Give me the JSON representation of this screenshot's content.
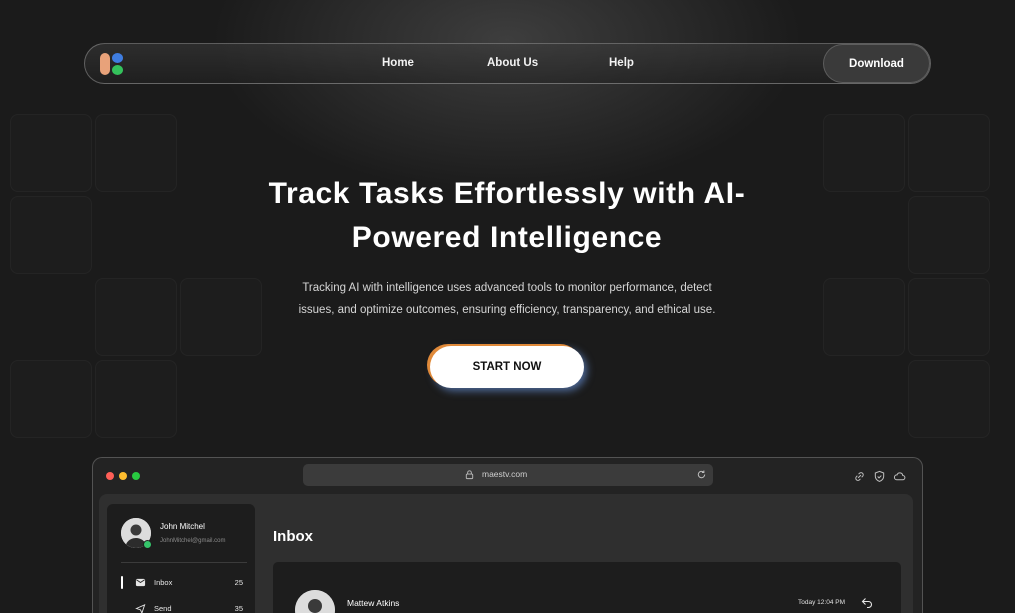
{
  "nav": {
    "links": [
      "Home",
      "About Us",
      "Help"
    ],
    "download_label": "Download"
  },
  "hero": {
    "title_line1": "Track Tasks Effortlessly with AI-",
    "title_line2": "Powered Intelligence",
    "subtitle_line1": "Tracking AI with intelligence uses advanced tools to monitor performance, detect",
    "subtitle_line2": "issues, and optimize outcomes, ensuring efficiency, transparency, and ethical use.",
    "cta_label": "START NOW"
  },
  "browser": {
    "url": "maestv.com",
    "traffic_lights": [
      "#ff5f57",
      "#febc2e",
      "#28c840"
    ],
    "toolbar_icons": [
      "link-icon",
      "shield-check-icon",
      "cloud-icon"
    ]
  },
  "app": {
    "user": {
      "name": "John Mitchel",
      "email": "JohnMitchel@gmail.com"
    },
    "sidebar_items": [
      {
        "label": "Inbox",
        "count": "25",
        "icon": "inbox-icon"
      },
      {
        "label": "Send",
        "count": "35",
        "icon": "send-icon"
      }
    ],
    "main_title": "Inbox",
    "message": {
      "sender": "Mattew Atkins",
      "time": "Today 12:04 PM"
    }
  },
  "colors": {
    "background": "#1b1b1b",
    "logo_orange": "#e8a27a",
    "logo_blue": "#3f7de0",
    "logo_green": "#34c25c",
    "cta_accent": "#e08a3a"
  }
}
